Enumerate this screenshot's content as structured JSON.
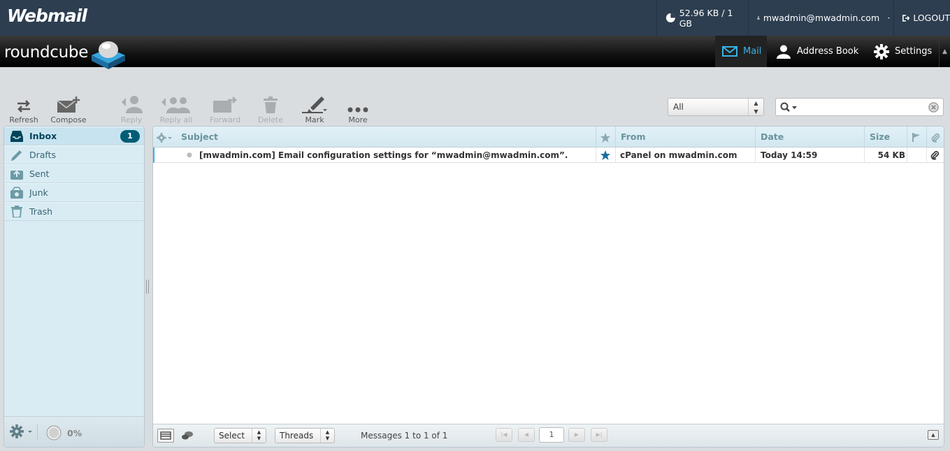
{
  "cpanel": {
    "logo": "Webmail",
    "quota": "52.96 KB / 1 GB",
    "user": "mwadmin@mwadmin.com",
    "logout": "LOGOUT"
  },
  "app": {
    "logo": "roundcube"
  },
  "nav": {
    "mail": "Mail",
    "address_book": "Address Book",
    "settings": "Settings"
  },
  "toolbar": {
    "refresh": "Refresh",
    "compose": "Compose",
    "reply": "Reply",
    "reply_all": "Reply all",
    "forward": "Forward",
    "delete": "Delete",
    "mark": "Mark",
    "more": "More"
  },
  "filter": {
    "selected": "All"
  },
  "search": {
    "value": ""
  },
  "folders": [
    {
      "label": "Inbox",
      "unread": "1",
      "icon": "inbox-icon"
    },
    {
      "label": "Drafts",
      "icon": "pencil-icon"
    },
    {
      "label": "Sent",
      "icon": "sent-icon"
    },
    {
      "label": "Junk",
      "icon": "junk-icon"
    },
    {
      "label": "Trash",
      "icon": "trash-icon"
    }
  ],
  "folder_footer": {
    "quota": "0%"
  },
  "list": {
    "columns": {
      "subject": "Subject",
      "from": "From",
      "date": "Date",
      "size": "Size"
    },
    "messages": [
      {
        "subject": "[mwadmin.com] Email configuration settings for “mwadmin@mwadmin.com”.",
        "from": "cPanel on mwadmin.com",
        "date": "Today 14:59",
        "size": "54 KB",
        "flagged": true,
        "attachment": true,
        "unread": true
      }
    ]
  },
  "list_footer": {
    "select": "Select",
    "threads": "Threads",
    "count": "Messages 1 to 1 of 1",
    "page": "1"
  },
  "colors": {
    "accent": "#37b3e6",
    "topbar": "#2d3e50",
    "badge": "#005d76"
  }
}
